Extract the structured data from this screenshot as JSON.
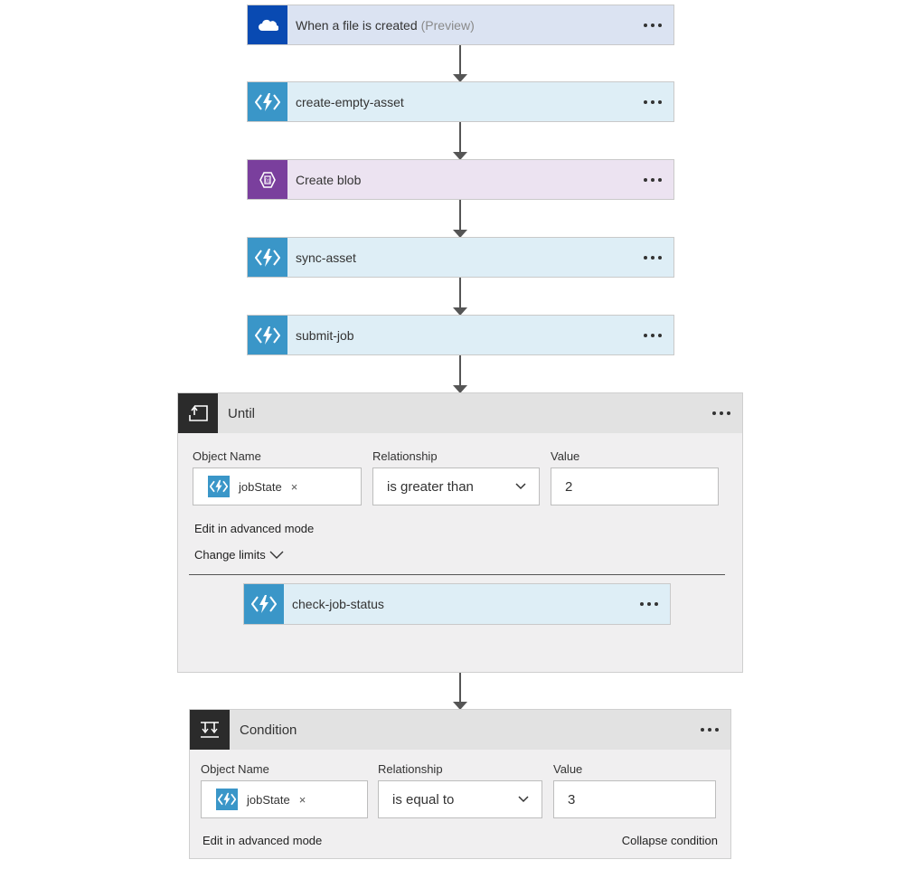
{
  "flow": {
    "trigger": {
      "label": "When a file is created",
      "tag": "(Preview)",
      "icon": "onedrive-cloud-icon",
      "color": "#094ab2"
    },
    "steps": [
      {
        "label": "create-empty-asset",
        "icon": "azure-function-icon"
      },
      {
        "label": "Create blob",
        "icon": "storage-blob-icon"
      },
      {
        "label": "sync-asset",
        "icon": "azure-function-icon"
      },
      {
        "label": "submit-job",
        "icon": "azure-function-icon"
      }
    ],
    "until": {
      "title": "Until",
      "object_name_label": "Object Name",
      "relationship_label": "Relationship",
      "value_label": "Value",
      "token": "jobState",
      "relationship": "is greater than",
      "value": "2",
      "advanced_link": "Edit in advanced mode",
      "change_limits": "Change limits",
      "inner_step": "check-job-status"
    },
    "condition": {
      "title": "Condition",
      "object_name_label": "Object Name",
      "relationship_label": "Relationship",
      "value_label": "Value",
      "token": "jobState",
      "relationship": "is equal to",
      "value": "3",
      "advanced_link": "Edit in advanced mode",
      "collapse_link": "Collapse condition"
    }
  },
  "colors": {
    "function_blue": "#3a96c8",
    "function_bg": "#deeef6",
    "blob_purple": "#7a3f9d",
    "blob_bg": "#ece3f1",
    "trigger_bg": "#dbe3f2",
    "scope_dark": "#2b2b2b"
  }
}
